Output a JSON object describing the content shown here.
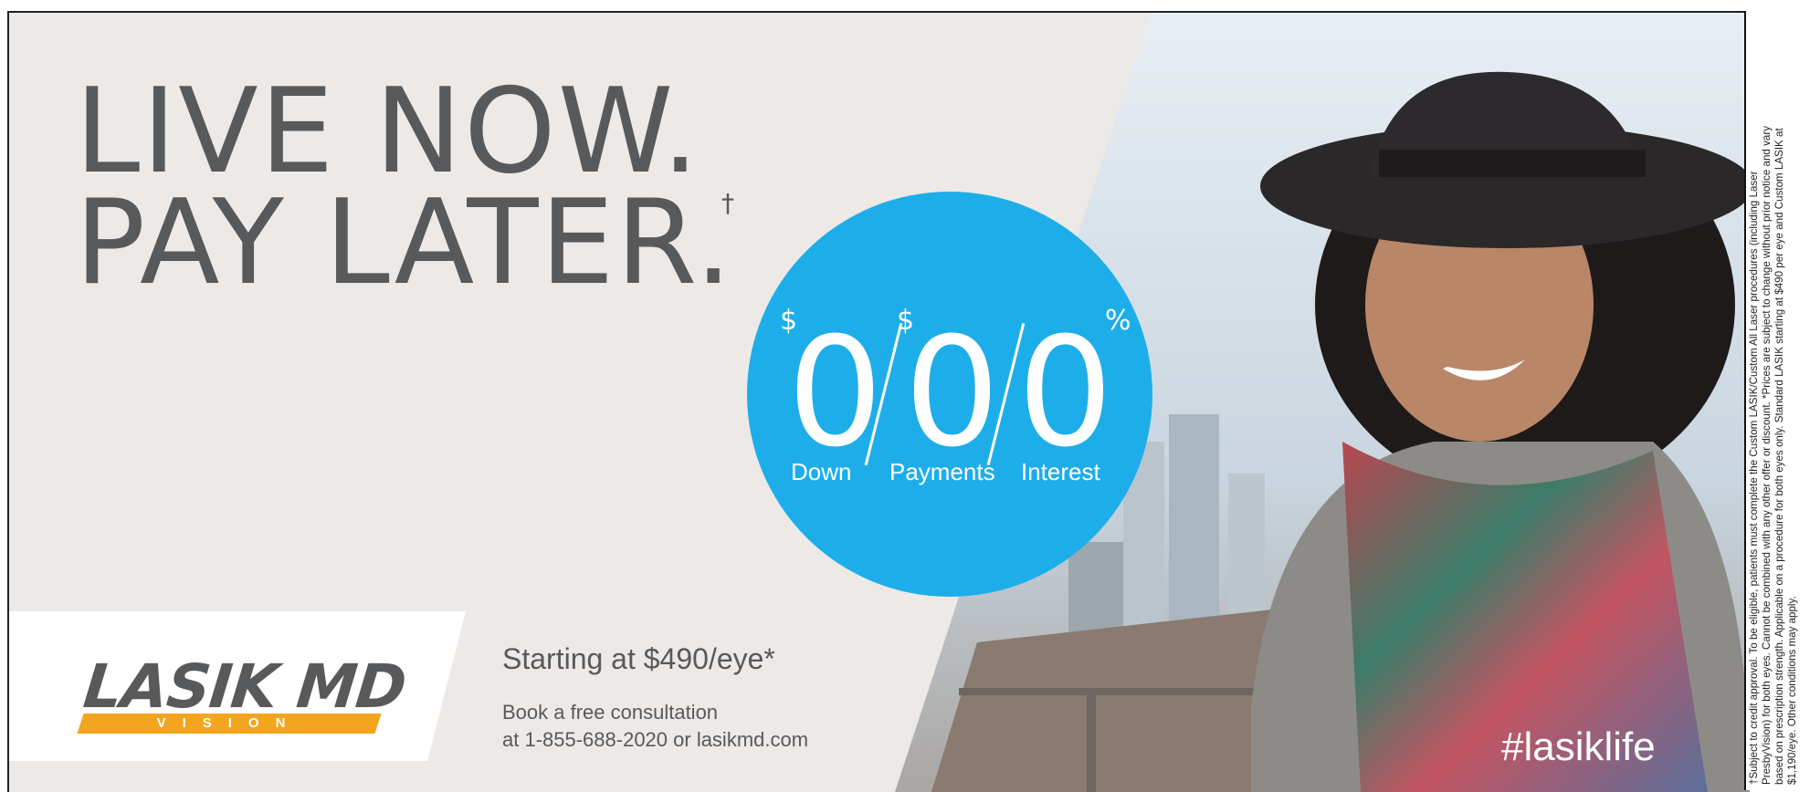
{
  "ad": {
    "headline_line1": "LIVE NOW.",
    "headline_line2": "PAY LATER.",
    "dagger": "†"
  },
  "offer": {
    "dollar_sign_1": "$",
    "dollar_sign_2": "$",
    "percent_sign": "%",
    "item1_value": "0",
    "item1_label": "Down",
    "item2_value": "0",
    "item2_label": "Payments",
    "item3_value": "0",
    "item3_label": "Interest"
  },
  "logo": {
    "name": "LASIK MD",
    "sub": "VISION"
  },
  "pricing": {
    "starting": "Starting at $490/eye*",
    "book_line1": "Book a free consultation",
    "book_line2": "at 1-855-688-2020 or lasikmd.com"
  },
  "hashtag": "#lasiklife",
  "fine_print": [
    "†Subject to credit approval. To be eligible, patients must complete the Custom LASIK/Custom All Laser procedures (including Laser",
    "PresbyVision) for both eyes. Cannot be combined with any other offer or discount. *Prices are subject to change without prior notice and vary",
    "based on prescription strength. Applicable on a procedure for both eyes only. Standard LASIK starting at $490 per eye and Custom LASIK at",
    "$1,190/eye.  Other conditions may apply."
  ],
  "colors": {
    "background": "#ece9e7",
    "headline_text": "#58595b",
    "offer_circle": "#1daeea",
    "logo_accent": "#f3a51e"
  }
}
